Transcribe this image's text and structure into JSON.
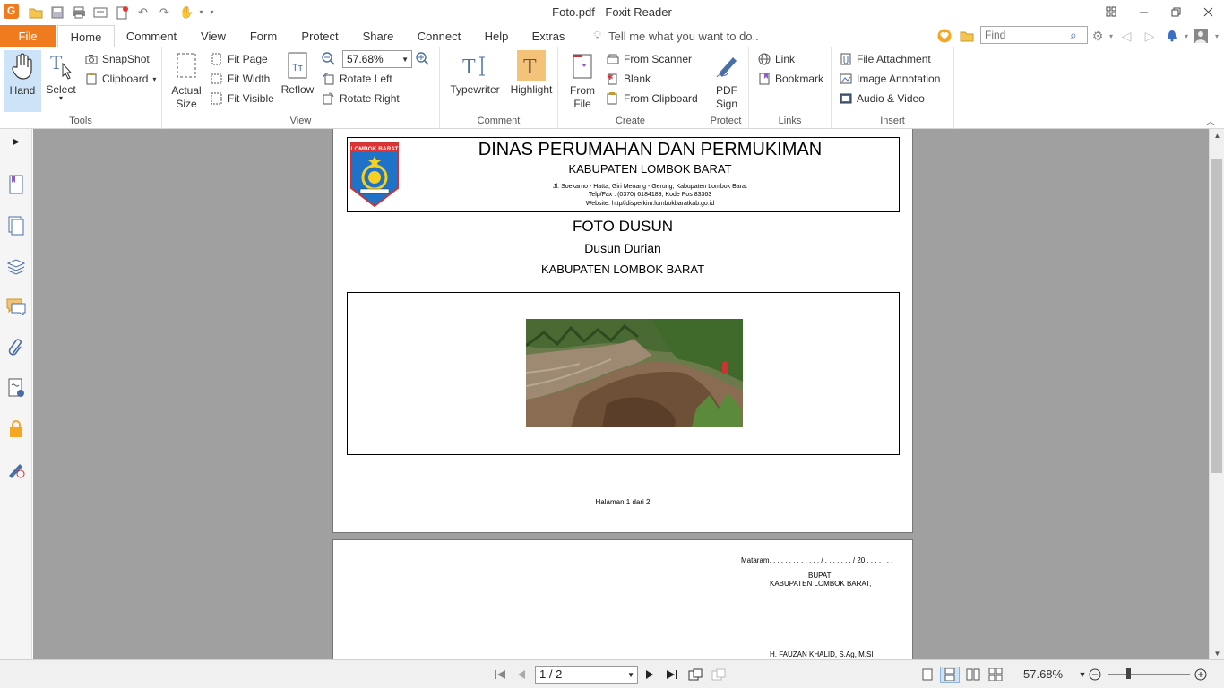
{
  "window": {
    "title": "Foto.pdf - Foxit Reader",
    "app_logo": "G"
  },
  "menu": {
    "file": "File",
    "tabs": [
      "Home",
      "Comment",
      "View",
      "Form",
      "Protect",
      "Share",
      "Connect",
      "Help",
      "Extras"
    ],
    "tell_me": "Tell me what you want to do..",
    "find_placeholder": "Find"
  },
  "ribbon": {
    "tools": {
      "hand": "Hand",
      "select": "Select",
      "snapshot": "SnapShot",
      "clipboard": "Clipboard",
      "label": "Tools"
    },
    "view": {
      "actual_size_1": "Actual",
      "actual_size_2": "Size",
      "fit_page": "Fit Page",
      "fit_width": "Fit Width",
      "fit_visible": "Fit Visible",
      "reflow": "Reflow",
      "zoom_value": "57.68%",
      "rotate_left": "Rotate Left",
      "rotate_right": "Rotate Right",
      "label": "View"
    },
    "comment": {
      "typewriter": "Typewriter",
      "highlight": "Highlight",
      "label": "Comment"
    },
    "create": {
      "from_file_1": "From",
      "from_file_2": "File",
      "from_scanner": "From Scanner",
      "blank": "Blank",
      "from_clipboard": "From Clipboard",
      "label": "Create"
    },
    "protect": {
      "pdf_sign_1": "PDF",
      "pdf_sign_2": "Sign",
      "label": "Protect"
    },
    "links": {
      "link": "Link",
      "bookmark": "Bookmark",
      "label": "Links"
    },
    "insert": {
      "file_attachment": "File Attachment",
      "image_annotation": "Image Annotation",
      "audio_video": "Audio & Video",
      "label": "Insert"
    }
  },
  "document": {
    "page1": {
      "letterhead": {
        "logo_text": "LOMBOK BARAT",
        "title": "DINAS PERUMAHAN DAN PERMUKIMAN",
        "subtitle": "KABUPATEN LOMBOK BARAT",
        "address": "Jl. Soekarno - Hatta, Giri Menang - Gerung,  Kabupaten Lombok Barat",
        "phone": "Telp/Fax : (0370) 6184189, Kode Pos 83363",
        "website": "Website: http//disperkim.lombokbaratkab.go.id"
      },
      "heading": "FOTO DUSUN",
      "subheading": "Dusun Durian",
      "region": "KABUPATEN LOMBOK BARAT",
      "footer": "Halaman 1 dari 2"
    },
    "page2": {
      "place_date": "Mataram, . . . . . . , . . . . . / . . . . . . . / 20 . . . . . . .",
      "role": "BUPATI",
      "region": "KABUPATEN LOMBOK BARAT,",
      "signer": "H. FAUZAN KHALID, S.Ag, M.SI"
    }
  },
  "status": {
    "page_value": "1 / 2",
    "zoom": "57.68%"
  }
}
